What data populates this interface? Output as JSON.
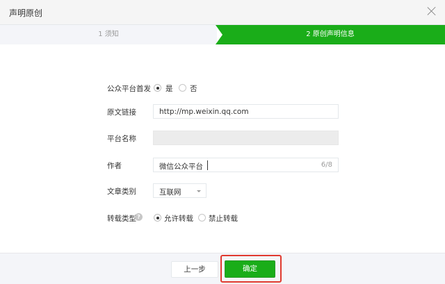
{
  "dialog": {
    "title": "声明原创"
  },
  "steps": [
    {
      "label": "1 须知",
      "active": false
    },
    {
      "label": "2 原创声明信息",
      "active": true
    }
  ],
  "form": {
    "first_publish": {
      "label": "公众平台首发",
      "options": [
        {
          "label": "是",
          "selected": true
        },
        {
          "label": "否",
          "selected": false
        }
      ]
    },
    "original_link": {
      "label": "原文链接",
      "value": "http://mp.weixin.qq.com"
    },
    "platform_name": {
      "label": "平台名称",
      "value": "",
      "disabled": true
    },
    "author": {
      "label": "作者",
      "value": "微信公众平台",
      "counter": "6/8"
    },
    "category": {
      "label": "文章类别",
      "value": "互联网"
    },
    "repost_type": {
      "label": "转载类型",
      "help_icon": "question-icon",
      "options": [
        {
          "label": "允许转载",
          "selected": true
        },
        {
          "label": "禁止转载",
          "selected": false
        }
      ]
    }
  },
  "footer": {
    "prev_label": "上一步",
    "confirm_label": "确定"
  },
  "colors": {
    "accent_green": "#1aad19",
    "highlight_red": "#e03a2f",
    "step_inactive_bg": "#f4f5f9"
  }
}
